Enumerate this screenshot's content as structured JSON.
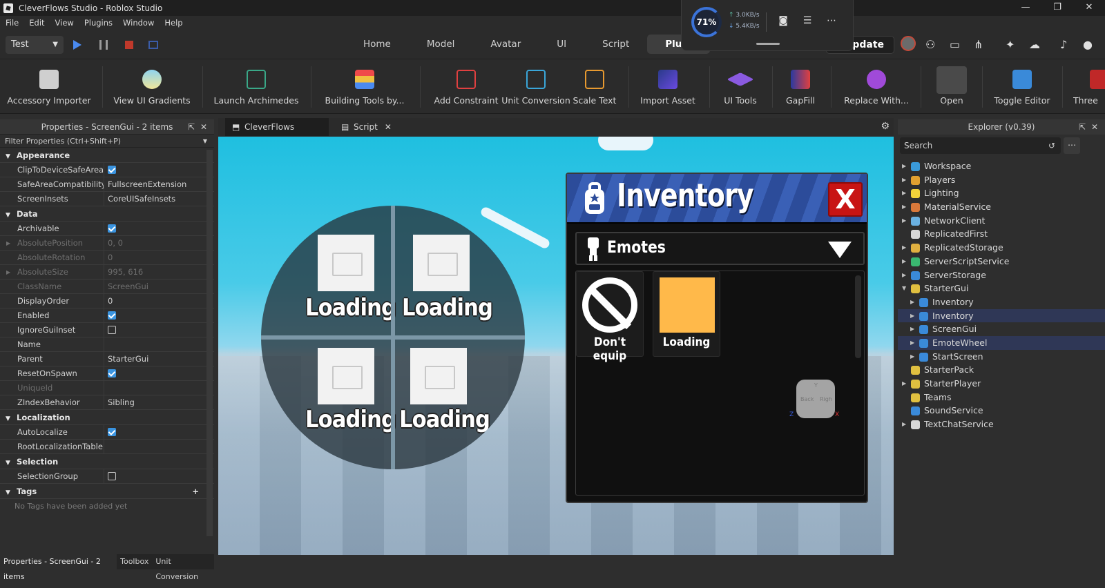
{
  "window": {
    "title": "CleverFlows Studio - Roblox Studio"
  },
  "menu": [
    "File",
    "Edit",
    "View",
    "Plugins",
    "Window",
    "Help"
  ],
  "net": {
    "percent": "71%",
    "up": "3.0KB/s",
    "down": "5.4KB/s"
  },
  "toolbar": {
    "mode": "Test",
    "tabs": [
      "Home",
      "Model",
      "Avatar",
      "UI",
      "Script",
      "Plugi"
    ],
    "update_label": "Update"
  },
  "ribbon": [
    "Accessory Importer",
    "View UI Gradients",
    "Launch Archimedes",
    "Building Tools by...",
    "Add Constraint",
    "Unit Conversion",
    "Scale Text",
    "Import Asset",
    "UI Tools",
    "GapFill",
    "Replace With...",
    "Open",
    "Toggle Editor",
    "Three"
  ],
  "properties": {
    "header": "Properties - ScreenGui - 2 items",
    "filter": "Filter Properties (Ctrl+Shift+P)",
    "sections": {
      "appearance": "Appearance",
      "data": "Data",
      "localization": "Localization",
      "selection": "Selection",
      "tags": "Tags"
    },
    "rows": {
      "clip": "ClipToDeviceSafeArea",
      "safearea": "SafeAreaCompatibility",
      "safearea_val": "FullscreenExtension",
      "insets": "ScreenInsets",
      "insets_val": "CoreUISafeInsets",
      "archivable": "Archivable",
      "abspos": "AbsolutePosition",
      "abspos_val": "0, 0",
      "absrot": "AbsoluteRotation",
      "absrot_val": "0",
      "abssize": "AbsoluteSize",
      "abssize_val": "995, 616",
      "classname": "ClassName",
      "classname_val": "ScreenGui",
      "displayorder": "DisplayOrder",
      "displayorder_val": "0",
      "enabled": "Enabled",
      "ignoreinset": "IgnoreGuiInset",
      "name": "Name",
      "parent": "Parent",
      "parent_val": "StarterGui",
      "reset": "ResetOnSpawn",
      "uniqueid": "UniqueId",
      "zindex": "ZIndexBehavior",
      "zindex_val": "Sibling",
      "autolocalize": "AutoLocalize",
      "roottable": "RootLocalizationTable",
      "selgroup": "SelectionGroup",
      "notags": "No Tags have been added yet"
    },
    "footer_tabs": [
      "Properties - ScreenGui - 2 items",
      "Toolbox",
      "Unit Conversion"
    ]
  },
  "doc_tabs": [
    "CleverFlows Studio",
    "Script"
  ],
  "viewport": {
    "wheel_labels": [
      "Loading",
      "Loading",
      "Loading",
      "Loading"
    ],
    "inventory": {
      "title": "Inventory",
      "close": "X",
      "category": "Emotes",
      "slot1": "Don't equip",
      "slot2": "Loading",
      "swatch_color": "#ffb94a"
    },
    "gizmo": {
      "back": "Back",
      "right": "Righ",
      "x": "X",
      "y": "Y",
      "z": "Z"
    }
  },
  "explorer": {
    "header": "Explorer (v0.39)",
    "search_placeholder": "Search",
    "items": [
      {
        "label": "Workspace",
        "depth": 0,
        "exp": "closed",
        "color": "#3a9ad9"
      },
      {
        "label": "Players",
        "depth": 0,
        "exp": "closed",
        "color": "#e0a030"
      },
      {
        "label": "Lighting",
        "depth": 0,
        "exp": "closed",
        "color": "#f2d23a"
      },
      {
        "label": "MaterialService",
        "depth": 0,
        "exp": "closed",
        "color": "#d9783a"
      },
      {
        "label": "NetworkClient",
        "depth": 0,
        "exp": "closed",
        "color": "#6ab0e0"
      },
      {
        "label": "ReplicatedFirst",
        "depth": 0,
        "exp": "none",
        "color": "#d8d8d8"
      },
      {
        "label": "ReplicatedStorage",
        "depth": 0,
        "exp": "closed",
        "color": "#e0b040"
      },
      {
        "label": "ServerScriptService",
        "depth": 0,
        "exp": "closed",
        "color": "#3ab870"
      },
      {
        "label": "ServerStorage",
        "depth": 0,
        "exp": "closed",
        "color": "#3a8ad9"
      },
      {
        "label": "StarterGui",
        "depth": 0,
        "exp": "open",
        "color": "#e0c040"
      },
      {
        "label": "Inventory",
        "depth": 1,
        "exp": "closed",
        "color": "#3a8ad9"
      },
      {
        "label": "Inventory",
        "depth": 1,
        "exp": "closed",
        "color": "#3a8ad9",
        "sel": true
      },
      {
        "label": "ScreenGui",
        "depth": 1,
        "exp": "closed",
        "color": "#3a8ad9"
      },
      {
        "label": "EmoteWheel",
        "depth": 1,
        "exp": "closed",
        "color": "#3a8ad9",
        "sel": true
      },
      {
        "label": "StartScreen",
        "depth": 1,
        "exp": "closed",
        "color": "#3a8ad9"
      },
      {
        "label": "StarterPack",
        "depth": 0,
        "exp": "none",
        "color": "#e0c040"
      },
      {
        "label": "StarterPlayer",
        "depth": 0,
        "exp": "closed",
        "color": "#e0c040"
      },
      {
        "label": "Teams",
        "depth": 0,
        "exp": "none",
        "color": "#e0c040"
      },
      {
        "label": "SoundService",
        "depth": 0,
        "exp": "none",
        "color": "#3a8ad9"
      },
      {
        "label": "TextChatService",
        "depth": 0,
        "exp": "closed",
        "color": "#d8d8d8"
      }
    ]
  }
}
